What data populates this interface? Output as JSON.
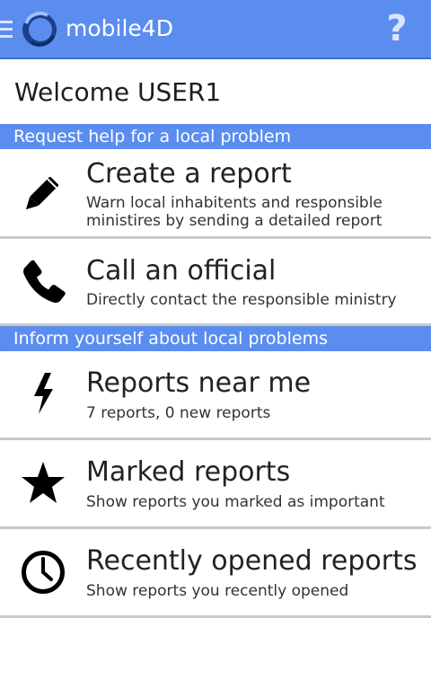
{
  "app": {
    "title": "mobile4D",
    "menu_icon": "menu-icon",
    "logo_icon": "mobile4d-logo-icon",
    "help_label": "?",
    "accent_color": "#5b8def"
  },
  "welcome": "Welcome USER1",
  "sections": [
    {
      "header": "Request help for a local problem",
      "items": [
        {
          "title": "Create a report",
          "subtitle": "Warn local inhabitents and responsible ministires by sending a detailed report",
          "icon": "pencil-icon"
        },
        {
          "title": "Call an official",
          "subtitle": "Directly contact the responsible ministry",
          "icon": "phone-icon"
        }
      ]
    },
    {
      "header": "Inform yourself about local problems",
      "items": [
        {
          "title": "Reports near me",
          "subtitle": "7 reports, 0 new reports",
          "icon": "lightning-icon"
        },
        {
          "title": "Marked reports",
          "subtitle": "Show reports you marked as important",
          "icon": "star-icon"
        },
        {
          "title": "Recently opened reports",
          "subtitle": "Show reports you recently opened",
          "icon": "clock-icon"
        }
      ]
    }
  ]
}
